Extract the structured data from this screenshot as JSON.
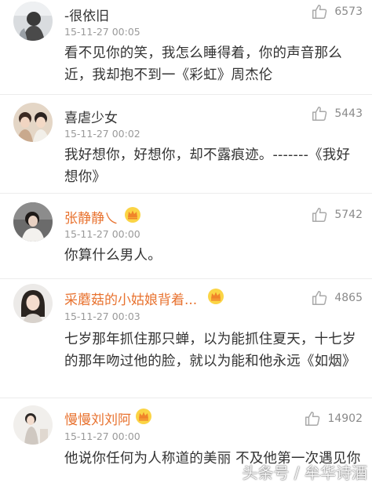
{
  "comments": [
    {
      "username": "-很依旧",
      "time": "15-11-27 00:05",
      "likes": "6573",
      "text": "看不见你的笑，我怎么睡得着，你的声音那么近，我却抱不到一《彩虹》周杰伦",
      "name_color": "#333333",
      "vip": false
    },
    {
      "username": "喜虐少女",
      "time": "15-11-27 00:02",
      "likes": "5443",
      "text": "我好想你，好想你，却不露痕迹。-------《我好想你》",
      "name_color": "#333333",
      "vip": false
    },
    {
      "username": "张静静乀",
      "time": "15-11-27 00:00",
      "likes": "5742",
      "text": "你算什么男人。",
      "name_color": "#e8722f",
      "vip": true
    },
    {
      "username": "采蘑菇的小姑娘背着...",
      "time": "15-11-27 00:03",
      "likes": "4865",
      "text": "七岁那年抓住那只蝉，以为能抓住夏天，十七岁的那年吻过他的脸，就以为能和他永远《如烟》",
      "name_color": "#e8722f",
      "vip": true
    },
    {
      "username": "慢慢刘刘阿",
      "time": "15-11-27 00:00",
      "likes": "14902",
      "text": "他说你任何为人称道的美丽 不及他第一次遇见你",
      "name_color": "#e8722f",
      "vip": true
    }
  ],
  "watermark": "头条号 / 牟华诗酒",
  "icons": {
    "like": "thumbs-up-icon",
    "vip": "crown-badge-icon"
  },
  "colors": {
    "orange_name": "#e8722f",
    "time": "#9a9a9a",
    "text": "#333333"
  }
}
